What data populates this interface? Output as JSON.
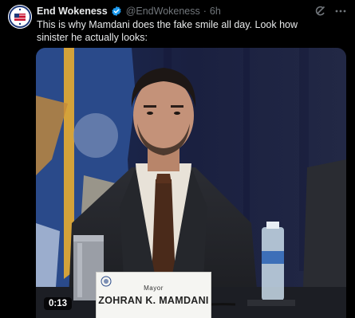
{
  "author": {
    "name": "End Wokeness",
    "handle": "@EndWokeness",
    "separator": "·",
    "time": "6h"
  },
  "tweet": {
    "text": "This is why Mamdani does the fake smile all day. Look how sinister he actually looks:"
  },
  "media": {
    "type": "video",
    "duration": "0:13",
    "placard": {
      "title": "Mayor",
      "name": "ZOHRAN K. MAMDANI"
    }
  },
  "icons": {
    "verified": "verified-badge-icon",
    "grok": "grok-icon",
    "more": "more-options-icon"
  },
  "colors": {
    "background": "#000000",
    "verified_blue": "#1d9bf0",
    "secondary_text": "#71767b",
    "primary_text": "#e7e9ea"
  }
}
